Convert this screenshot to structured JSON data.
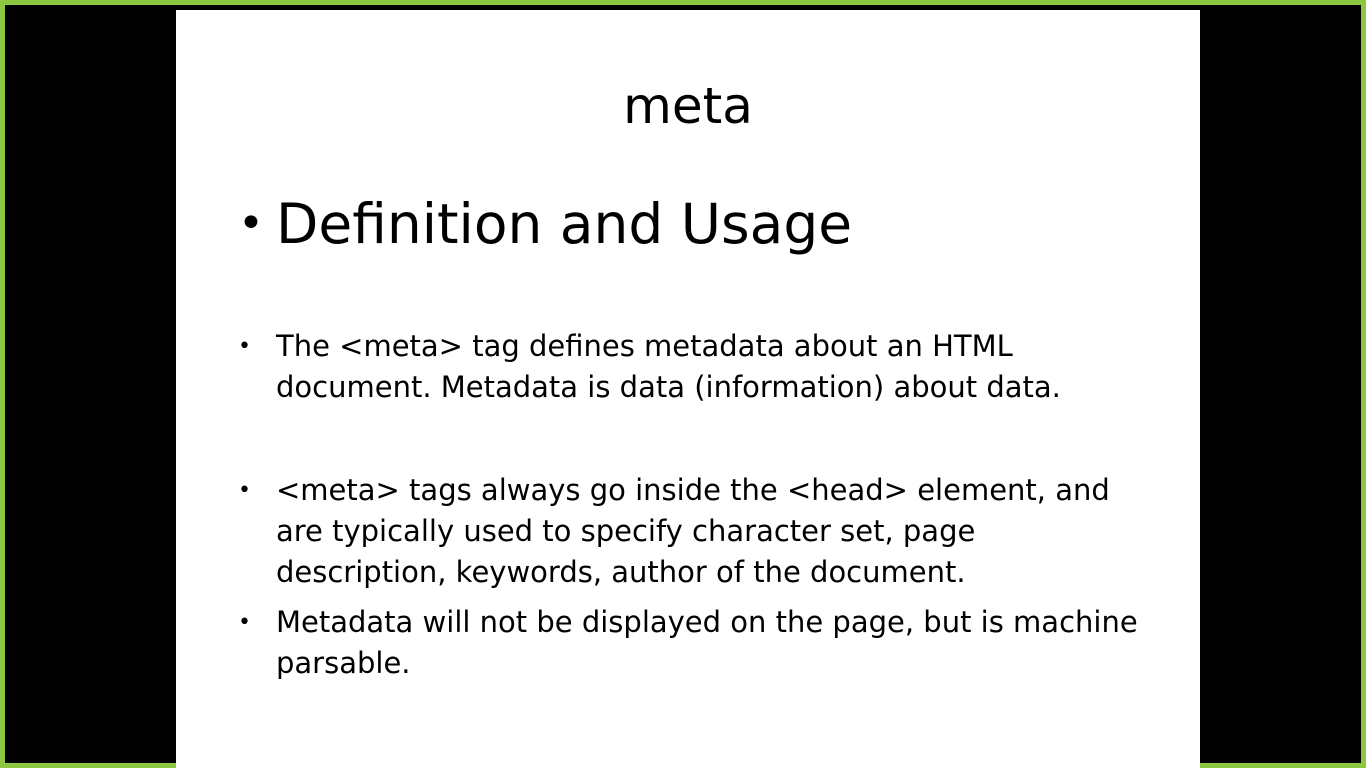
{
  "slide": {
    "title": "meta",
    "heading": "Definition and Usage",
    "bullet_glyph": "•",
    "bullets": [
      "The <meta> tag defines metadata about an HTML document. Metadata is data (information) about data.",
      "<meta> tags always go inside the <head> element, and are typically used to specify character set, page description, keywords, author of the document.",
      "Metadata will not be displayed on the page, but is machine parsable."
    ]
  },
  "colors": {
    "frame_border": "#8dc63f",
    "letterbox": "#000000",
    "slide_background": "#ffffff",
    "text": "#000000"
  }
}
